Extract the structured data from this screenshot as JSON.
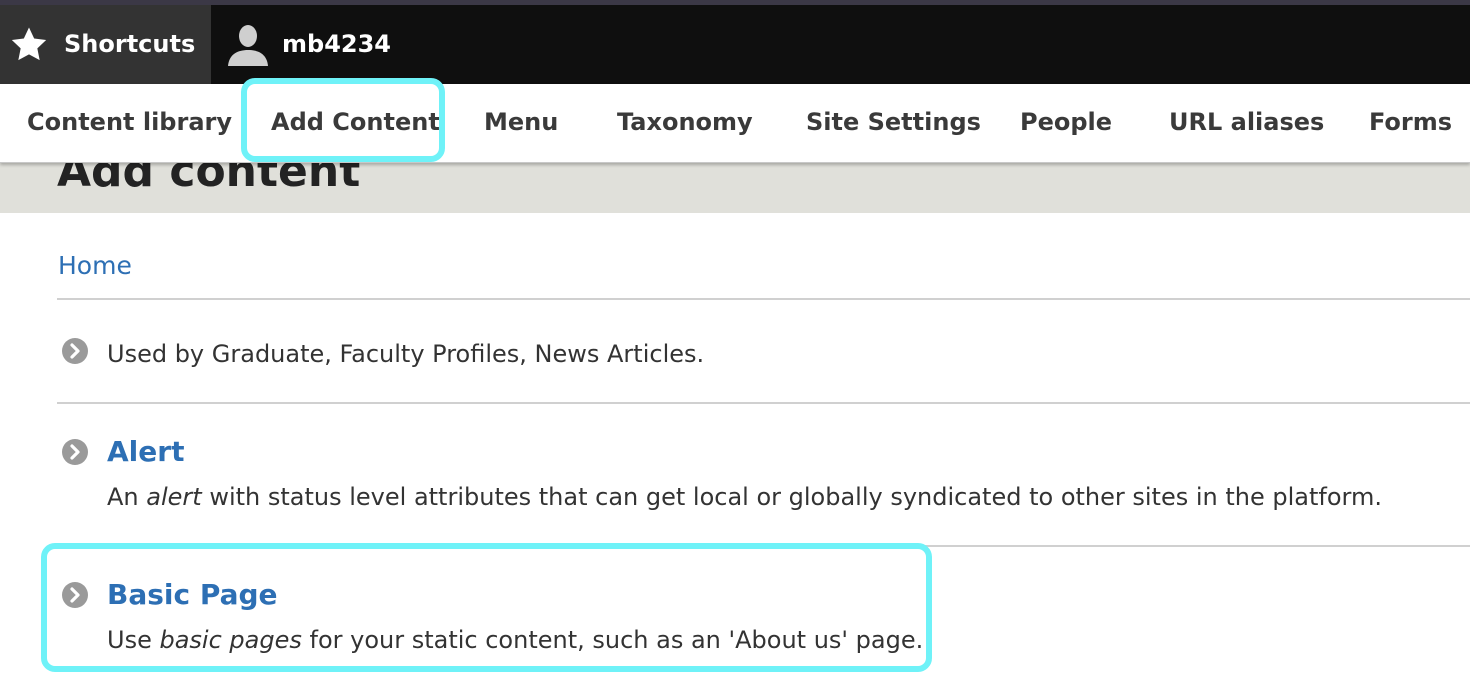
{
  "toolbar": {
    "shortcuts_label": "Shortcuts",
    "user_label": "mb4234"
  },
  "tray": {
    "items": [
      "Content library",
      "Add Content",
      "Menu",
      "Taxonomy",
      "Site Settings",
      "People",
      "URL aliases",
      "Forms"
    ],
    "active_index": 1
  },
  "page": {
    "title": "Add content",
    "breadcrumb": "Home"
  },
  "entries": [
    {
      "title": "",
      "description": "Used by Graduate, Faculty Profiles, News Articles."
    },
    {
      "title": "Alert",
      "description_before": "An ",
      "description_em": "alert",
      "description_after": " with status level attributes that can get local or globally syndicated to other sites in the platform."
    },
    {
      "title": "Basic Page",
      "description_before": "Use ",
      "description_em": "basic pages",
      "description_after": " for your static content, such as an 'About us' page."
    }
  ],
  "colors": {
    "link": "#2d6fb4",
    "highlight": "#6ff2f8",
    "toolbar_bg": "#0f0f0f",
    "page_header_bg": "#e0e0da"
  },
  "icons": {
    "shortcuts": "star-icon",
    "user": "user-icon",
    "entry": "chevron-circle-icon"
  }
}
